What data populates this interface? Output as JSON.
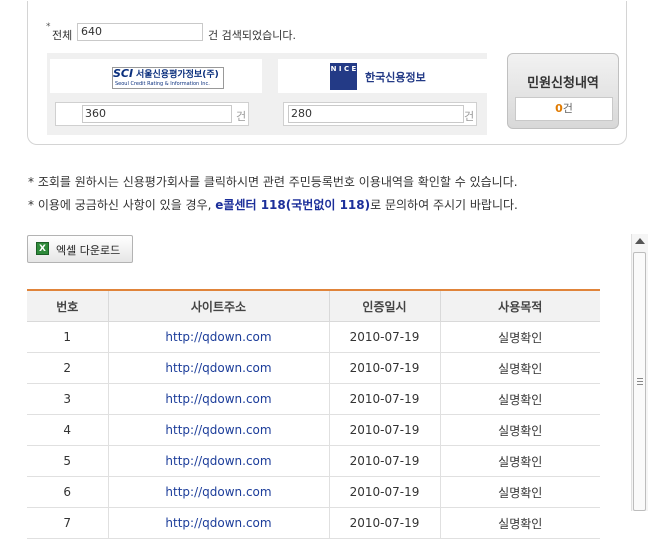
{
  "summary": {
    "bullet": "*",
    "total_label": "전체",
    "total_value": "640",
    "total_suffix": "건 검색되었습니다."
  },
  "agencies": [
    {
      "logo_abbr": "SCI",
      "logo_name": "서울신용평가정보(주)",
      "logo_sub": "Seoul Credit Rating & Information Inc.",
      "count": "360",
      "unit": "건"
    },
    {
      "logo_mark": "N I C E",
      "logo_name": "한국신용정보",
      "count": "280",
      "unit": "건"
    }
  ],
  "civil": {
    "title": "민원신청내역",
    "count": "0",
    "unit": "건"
  },
  "notices": {
    "line1": "* 조회를 원하시는 신용평가회사를 클릭하시면 관련 주민등록번호 이용내역을 확인할 수 있습니다.",
    "line2_before": "* 이용에 궁금하신 사항이 있을 경우, ",
    "line2_highlight": "e콜센터 118(국번없이 118)",
    "line2_after": "로 문의하여 주시기 바랍니다."
  },
  "excel_button": {
    "icon": "excel-icon",
    "label": "엑셀 다운로드"
  },
  "table": {
    "headers": [
      "번호",
      "사이트주소",
      "인증일시",
      "사용목적"
    ],
    "rows": [
      [
        "1",
        "http://qdown.com",
        "2010-07-19",
        "실명확인"
      ],
      [
        "2",
        "http://qdown.com",
        "2010-07-19",
        "실명확인"
      ],
      [
        "3",
        "http://qdown.com",
        "2010-07-19",
        "실명확인"
      ],
      [
        "4",
        "http://qdown.com",
        "2010-07-19",
        "실명확인"
      ],
      [
        "5",
        "http://qdown.com",
        "2010-07-19",
        "실명확인"
      ],
      [
        "6",
        "http://qdown.com",
        "2010-07-19",
        "실명확인"
      ],
      [
        "7",
        "http://qdown.com",
        "2010-07-19",
        "실명확인"
      ]
    ]
  },
  "colors": {
    "accent_orange": "#e0843a",
    "link_blue": "#1c3d9a",
    "count_orange": "#e07a00"
  }
}
